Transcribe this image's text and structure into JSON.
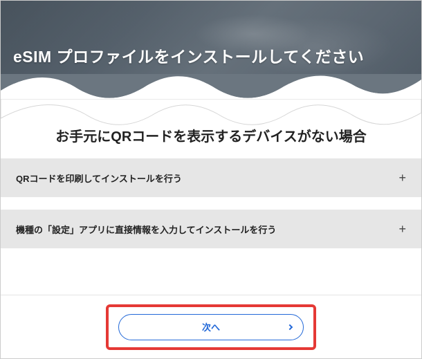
{
  "hero": {
    "title": "eSIM プロファイルをインストールしてください"
  },
  "section": {
    "title": "お手元にQRコードを表示するデバイスがない場合"
  },
  "accordion": {
    "items": [
      {
        "label": "QRコードを印刷してインストールを行う",
        "expand_icon": "+"
      },
      {
        "label": "機種の「設定」アプリに直接情報を入力してインストールを行う",
        "expand_icon": "+"
      }
    ]
  },
  "footer": {
    "next_label": "次へ"
  }
}
